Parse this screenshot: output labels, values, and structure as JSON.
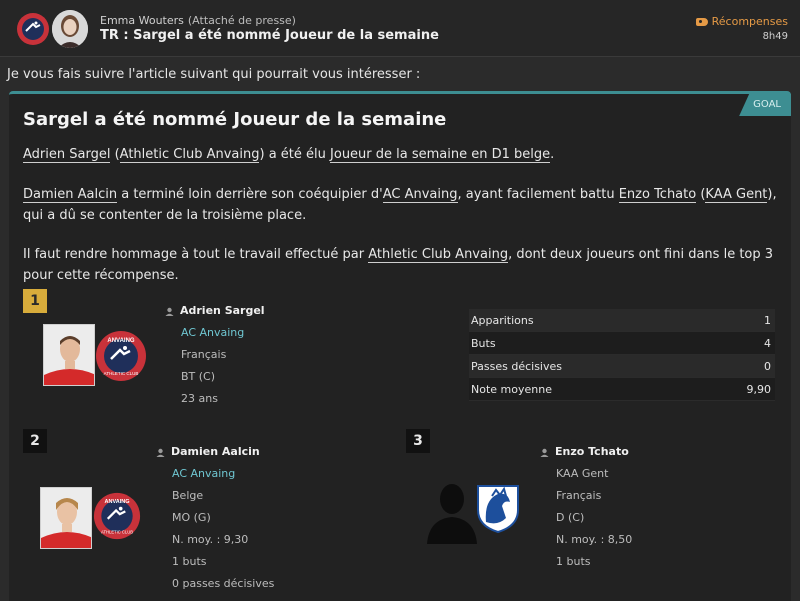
{
  "header": {
    "sender_name": "Emma Wouters",
    "sender_role": "(Attaché de presse)",
    "subject": "TR : Sargel a été nommé Joueur de la semaine",
    "tag_label": "Récompenses",
    "time": "8h49"
  },
  "intro": "Je vous fais suivre l'article suivant qui pourrait vous intéresser :",
  "article": {
    "badge": "GOAL",
    "title": "Sargel a été nommé Joueur de la semaine",
    "p1": {
      "player": "Adrien Sargel",
      "club": "Athletic Club Anvaing",
      "text_mid": "a été élu",
      "award": "Joueur de la semaine en D1 belge"
    },
    "p2": {
      "player": "Damien Aalcin",
      "text1": "a terminé loin derrière son coéquipier d'",
      "club": "AC Anvaing",
      "text2": ", ayant facilement battu",
      "rival": "Enzo Tchato",
      "rival_club": "KAA Gent",
      "text3": ", qui a dû se contenter de la troisième place."
    },
    "p3": {
      "text1": "Il faut rendre hommage à tout le travail effectué par",
      "club": "Athletic Club Anvaing",
      "text2": ", dont deux joueurs ont fini dans le top 3 pour cette récompense."
    }
  },
  "ranking": [
    {
      "rank": "1",
      "name": "Adrien Sargel",
      "club": "AC Anvaing",
      "nationality": "Français",
      "position": "BT (C)",
      "age": "23 ans"
    },
    {
      "rank": "2",
      "name": "Damien Aalcin",
      "club": "AC Anvaing",
      "nationality": "Belge",
      "position": "MO (G)",
      "avg_rating": "N. moy. : 9,30",
      "goals": "1 buts",
      "assists": "0 passes décisives"
    },
    {
      "rank": "3",
      "name": "Enzo Tchato",
      "club": "KAA Gent",
      "nationality": "Français",
      "position": "D (C)",
      "avg_rating": "N. moy. : 8,50",
      "goals": "1 buts"
    }
  ],
  "stats": [
    {
      "label": "Apparitions",
      "value": "1"
    },
    {
      "label": "Buts",
      "value": "4"
    },
    {
      "label": "Passes décisives",
      "value": "0"
    },
    {
      "label": "Note moyenne",
      "value": "9,90"
    }
  ],
  "crest_text": {
    "anvaing_top": "ANVAING",
    "anvaing_bottom": "ATHLETIC CLUB"
  },
  "colors": {
    "accent": "#3d8e92",
    "club_link": "#6fc6d1",
    "tag": "#e59a46",
    "gold": "#d8ac3b"
  }
}
